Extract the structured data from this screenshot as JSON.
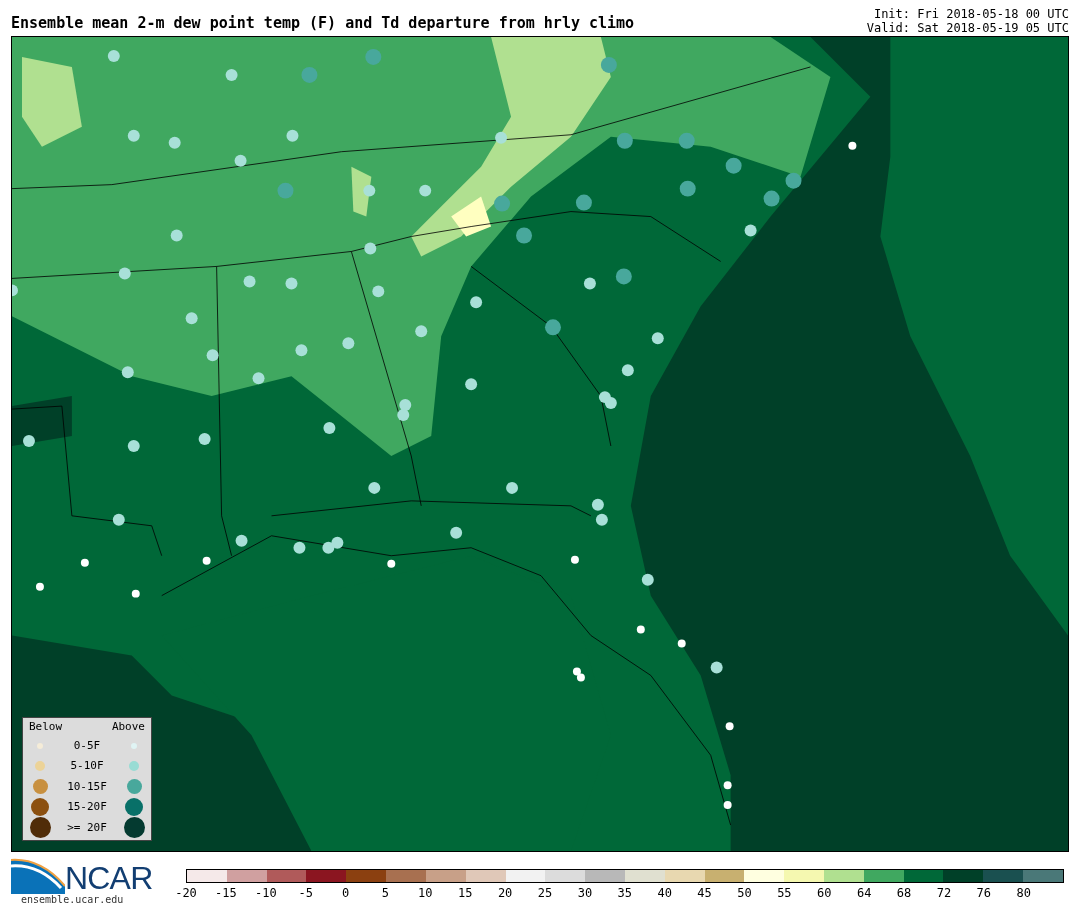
{
  "title": "Ensemble mean 2-m dew point temp (F) and Td departure from hrly climo",
  "init": "Init: Fri 2018-05-18 00 UTC",
  "valid": "Valid: Sat 2018-05-19 05 UTC",
  "legend": {
    "below_heading": "Below",
    "above_heading": "Above",
    "rows": [
      {
        "label": "0-5F",
        "below": {
          "color": "#f5ecd8"
        },
        "above": {
          "color": "#e0f4f4"
        }
      },
      {
        "label": "5-10F",
        "below": {
          "color": "#ecd398"
        },
        "above": {
          "color": "#98dcd4"
        }
      },
      {
        "label": "10-15F",
        "below": {
          "color": "#c89040"
        },
        "above": {
          "color": "#48a89c"
        }
      },
      {
        "label": "15-20F",
        "below": {
          "color": "#8c5010"
        },
        "above": {
          "color": "#087068"
        }
      },
      {
        "label": ">= 20F",
        "below": {
          "color": "#502c08"
        },
        "above": {
          "color": "#043a30"
        }
      }
    ]
  },
  "logo": {
    "text": "NCAR",
    "url": "ensemble.ucar.edu"
  },
  "colorbar": {
    "segments": [
      {
        "color": "#f5e9e9"
      },
      {
        "color": "#d0a0a0"
      },
      {
        "color": "#b05a5a"
      },
      {
        "color": "#8b1520"
      },
      {
        "color": "#8b4010"
      },
      {
        "color": "#a87050"
      },
      {
        "color": "#c8a088"
      },
      {
        "color": "#e0c8b8"
      },
      {
        "color": "#f2f2f2"
      },
      {
        "color": "#dcdcdc"
      },
      {
        "color": "#b8b8b8"
      },
      {
        "color": "#e0e0d0"
      },
      {
        "color": "#e8d8b0"
      },
      {
        "color": "#c8b070"
      },
      {
        "color": "#ffffe0"
      },
      {
        "color": "#f5f8b0"
      },
      {
        "color": "#b0e090"
      },
      {
        "color": "#40a860"
      },
      {
        "color": "#006838"
      },
      {
        "color": "#004028"
      },
      {
        "color": "#1a5050"
      },
      {
        "color": "#4a7878"
      }
    ],
    "ticks": [
      "-20",
      "-15",
      "-10",
      "-5",
      "0",
      "5",
      "10",
      "15",
      "20",
      "25",
      "30",
      "35",
      "40",
      "45",
      "50",
      "55",
      "60",
      "64",
      "68",
      "72",
      "76",
      "80"
    ]
  }
}
